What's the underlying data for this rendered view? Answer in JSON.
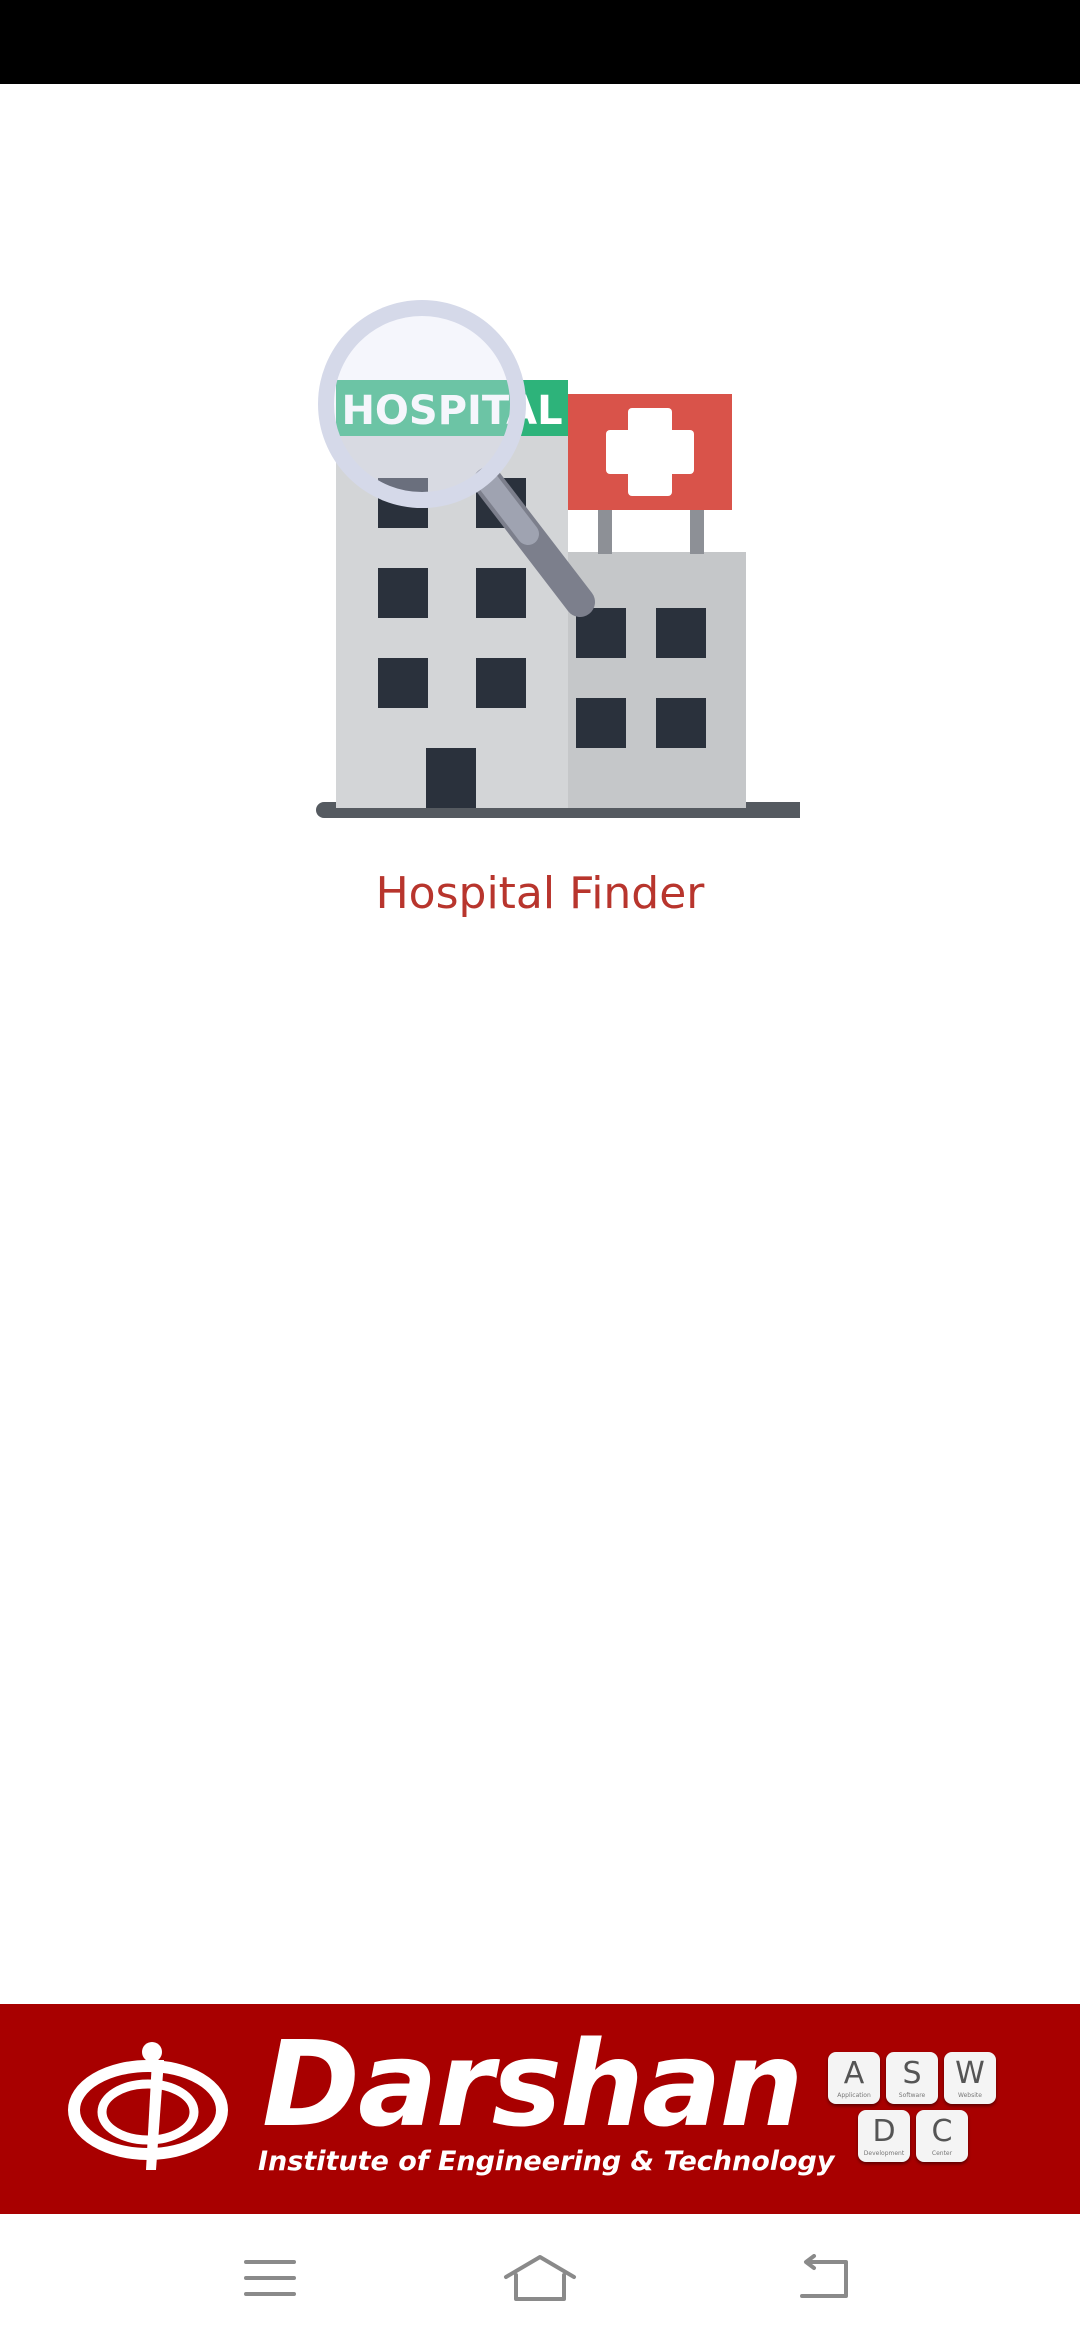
{
  "app": {
    "title": "Hospital Finder",
    "illustration_sign": "HOSPITAL"
  },
  "colors": {
    "title": "#b8352d",
    "banner": "#a80000",
    "sign_green": "#2db37a",
    "cross_red": "#d9534a"
  },
  "banner": {
    "brand_name": "Darshan",
    "tagline": "Institute of Engineering & Technology",
    "keys": [
      {
        "letter": "A",
        "sub": "Application"
      },
      {
        "letter": "S",
        "sub": "Software"
      },
      {
        "letter": "W",
        "sub": "Website"
      },
      {
        "letter": "D",
        "sub": "Development"
      },
      {
        "letter": "C",
        "sub": "Center"
      }
    ]
  },
  "nav": {
    "icons": [
      "menu-icon",
      "home-icon",
      "back-icon"
    ]
  }
}
